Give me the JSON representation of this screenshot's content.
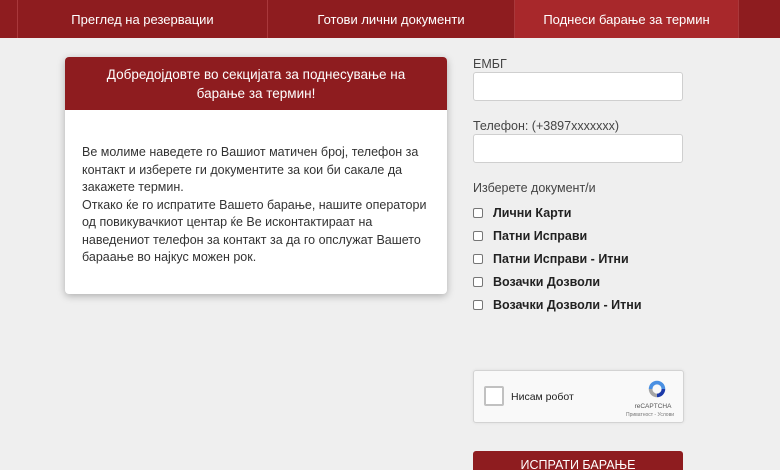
{
  "nav": {
    "tabs": [
      {
        "label": "Преглед на резервации"
      },
      {
        "label": "Готови лични документи"
      },
      {
        "label": "Поднеси барање за термин"
      }
    ]
  },
  "welcome": {
    "title": "Добредојдовте во секцијата за поднесување на барање за термин!",
    "line1": "Ве молиме наведете го Вашиот матичен број, телефон за контакт и изберете ги документите за кои би сакале да закажете термин.",
    "line2": "Откако ќе го испратите Вашето барање, нашите оператори од повикувачкиот центар ќе Ве исконтактираат на наведениот телефон за контакт за да го опслужат Вашето бараање во најкус можен рок."
  },
  "form": {
    "embg_label": "ЕМБГ",
    "phone_label": "Телефон: (+3897xxxxxxx)",
    "docs_label": "Изберете документ/и",
    "documents": [
      {
        "label": "Лични Карти"
      },
      {
        "label": "Патни Исправи"
      },
      {
        "label": "Патни Исправи - Итни"
      },
      {
        "label": "Возачки Дозволи"
      },
      {
        "label": "Возачки Дозволи - Итни"
      }
    ],
    "submit_label": "ИСПРАТИ БАРАЊЕ"
  },
  "captcha": {
    "label": "Нисам робот",
    "brand": "reCAPTCHA",
    "links": "Приватност - Услови"
  },
  "colors": {
    "brand": "#8e1c1f",
    "active_tab": "#a8282b",
    "background": "#efefef"
  }
}
